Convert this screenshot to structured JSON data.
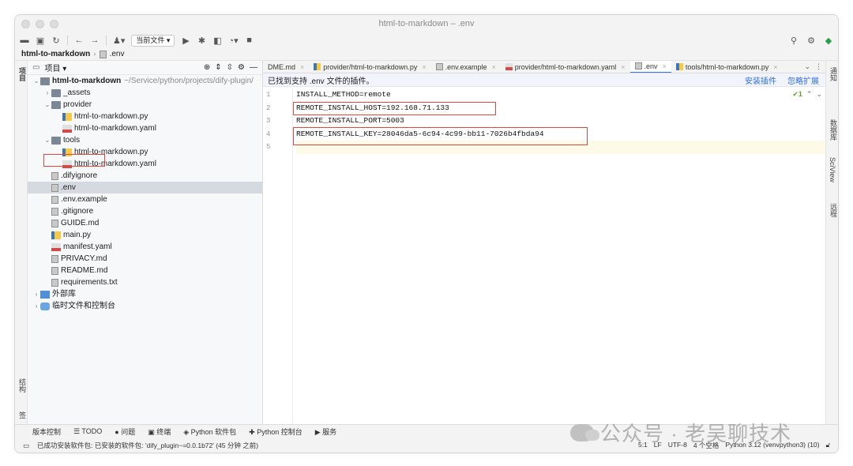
{
  "window": {
    "title": "html-to-markdown – .env"
  },
  "toolbar": {
    "current_file": "当前文件 ▾"
  },
  "breadcrumb": {
    "project": "html-to-markdown",
    "file": ".env"
  },
  "left_strip": {
    "project": "项目",
    "structure": "结构",
    "bookmarks": "书签"
  },
  "right_strip": {
    "notifications": "通知",
    "database": "数据库",
    "sciview": "SciView",
    "remote": "远程"
  },
  "project_panel": {
    "title": "项目 ▾",
    "tree": [
      {
        "indent": 0,
        "chev": "⌄",
        "icon": "folder",
        "label": "html-to-markdown",
        "path": "~/Service/python/projects/dify-plugin/",
        "bold": true
      },
      {
        "indent": 1,
        "chev": "›",
        "icon": "folder",
        "label": "_assets"
      },
      {
        "indent": 1,
        "chev": "⌄",
        "icon": "folder",
        "label": "provider"
      },
      {
        "indent": 2,
        "chev": "",
        "icon": "py",
        "label": "html-to-markdown.py"
      },
      {
        "indent": 2,
        "chev": "",
        "icon": "yaml",
        "label": "html-to-markdown.yaml"
      },
      {
        "indent": 1,
        "chev": "⌄",
        "icon": "folder",
        "label": "tools"
      },
      {
        "indent": 2,
        "chev": "",
        "icon": "py",
        "label": "html-to-markdown.py"
      },
      {
        "indent": 2,
        "chev": "",
        "icon": "yaml",
        "label": "html-to-markdown.yaml"
      },
      {
        "indent": 1,
        "chev": "",
        "icon": "txt",
        "label": ".difyignore"
      },
      {
        "indent": 1,
        "chev": "",
        "icon": "txt",
        "label": ".env",
        "selected": true
      },
      {
        "indent": 1,
        "chev": "",
        "icon": "txt",
        "label": ".env.example"
      },
      {
        "indent": 1,
        "chev": "",
        "icon": "txt",
        "label": ".gitignore"
      },
      {
        "indent": 1,
        "chev": "",
        "icon": "txt",
        "label": "GUIDE.md"
      },
      {
        "indent": 1,
        "chev": "",
        "icon": "py",
        "label": "main.py"
      },
      {
        "indent": 1,
        "chev": "",
        "icon": "yaml",
        "label": "manifest.yaml"
      },
      {
        "indent": 1,
        "chev": "",
        "icon": "txt",
        "label": "PRIVACY.md"
      },
      {
        "indent": 1,
        "chev": "",
        "icon": "txt",
        "label": "README.md"
      },
      {
        "indent": 1,
        "chev": "",
        "icon": "txt",
        "label": "requirements.txt"
      },
      {
        "indent": 0,
        "chev": "›",
        "icon": "lib",
        "label": "外部库"
      },
      {
        "indent": 0,
        "chev": "›",
        "icon": "tmp",
        "label": "临时文件和控制台"
      }
    ]
  },
  "tabs": [
    {
      "label": "DME.md",
      "icon": "txt"
    },
    {
      "label": "provider/html-to-markdown.py",
      "icon": "py"
    },
    {
      "label": ".env.example",
      "icon": "txt"
    },
    {
      "label": "provider/html-to-markdown.yaml",
      "icon": "yaml"
    },
    {
      "label": ".env",
      "icon": "txt",
      "active": true
    },
    {
      "label": "tools/html-to-markdown.py",
      "icon": "py"
    }
  ],
  "notification": {
    "text": "已找到支持 .env 文件的插件。",
    "install": "安装插件",
    "ignore": "忽略扩展"
  },
  "editor": {
    "line_numbers": [
      "1",
      "2",
      "3",
      "4",
      "5"
    ],
    "lines": [
      "INSTALL_METHOD=remote",
      "REMOTE_INSTALL_HOST=192.168.71.133",
      "REMOTE_INSTALL_PORT=5003",
      "REMOTE_INSTALL_KEY=28046da5-6c94-4c99-bb11-7026b4fbda94",
      ""
    ],
    "inspection": "✔1"
  },
  "bottom_tools": [
    "版本控制",
    "☰ TODO",
    "● 问题",
    "▣ 终端",
    "◈ Python 软件包",
    "✚ Python 控制台",
    "▶ 服务"
  ],
  "status": {
    "message": "已成功安装软件包: 已安装的软件包: 'dify_plugin~=0.0.1b72' (45 分钟 之前)",
    "position": "5:1",
    "line_sep": "LF",
    "encoding": "UTF-8",
    "indent": "4 个空格",
    "interpreter": "Python 3.12 (venvpython3) (10)"
  },
  "watermark": "公众号 · 老吴聊技术",
  "colors": {
    "accent": "#3574f0",
    "highlight_box": "#e0473d",
    "link": "#2f6fdb"
  }
}
